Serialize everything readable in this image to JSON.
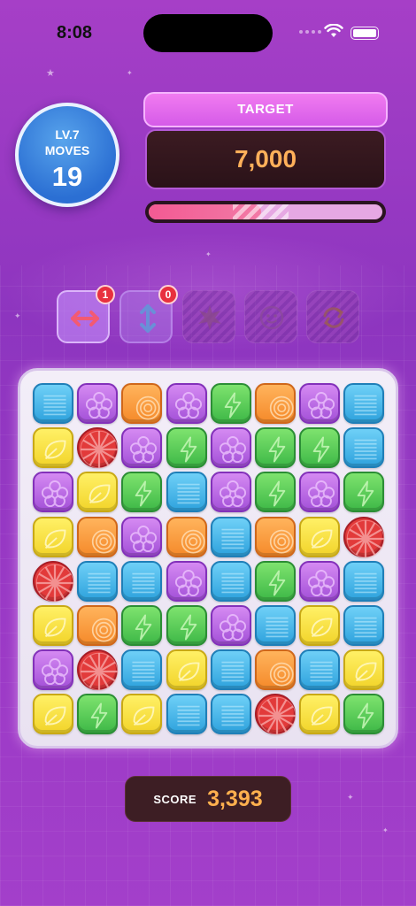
{
  "status_bar": {
    "time": "8:08"
  },
  "level": {
    "level_label": "LV.7",
    "moves_label": "MOVES",
    "moves_value": "19"
  },
  "target": {
    "label": "TARGET",
    "value": "7,000",
    "progress_percent": 48
  },
  "boosters": [
    {
      "icon": "horizontal-arrows-icon",
      "count": "1",
      "state": "active"
    },
    {
      "icon": "vertical-arrows-icon",
      "count": "0",
      "state": "empty"
    },
    {
      "icon": "burst-icon",
      "state": "locked"
    },
    {
      "icon": "smiley-icon",
      "state": "locked"
    },
    {
      "icon": "shuffle-icon",
      "state": "locked"
    }
  ],
  "board": {
    "rows": 8,
    "cols": 8,
    "tiles": [
      [
        "blue",
        "purple",
        "orange",
        "purple",
        "green",
        "orange",
        "purple",
        "blue"
      ],
      [
        "yellow",
        "red",
        "purple",
        "green",
        "purple",
        "green",
        "green",
        "blue"
      ],
      [
        "purple",
        "yellow",
        "green",
        "blue",
        "purple",
        "green",
        "purple",
        "green"
      ],
      [
        "yellow",
        "orange",
        "purple",
        "orange",
        "blue",
        "orange",
        "yellow",
        "red"
      ],
      [
        "red",
        "blue",
        "blue",
        "purple",
        "blue",
        "green",
        "purple",
        "blue"
      ],
      [
        "yellow",
        "orange",
        "green",
        "green",
        "purple",
        "blue",
        "yellow",
        "blue"
      ],
      [
        "purple",
        "red",
        "blue",
        "yellow",
        "blue",
        "orange",
        "blue",
        "yellow"
      ],
      [
        "yellow",
        "green",
        "yellow",
        "blue",
        "blue",
        "red",
        "yellow",
        "green"
      ]
    ]
  },
  "score": {
    "label": "SCORE",
    "value": "3,393"
  },
  "colors": {
    "background": "#9b3ac6",
    "target_value": "#ffb05a",
    "score_value": "#ffb04e",
    "badge": "#e8303e"
  }
}
